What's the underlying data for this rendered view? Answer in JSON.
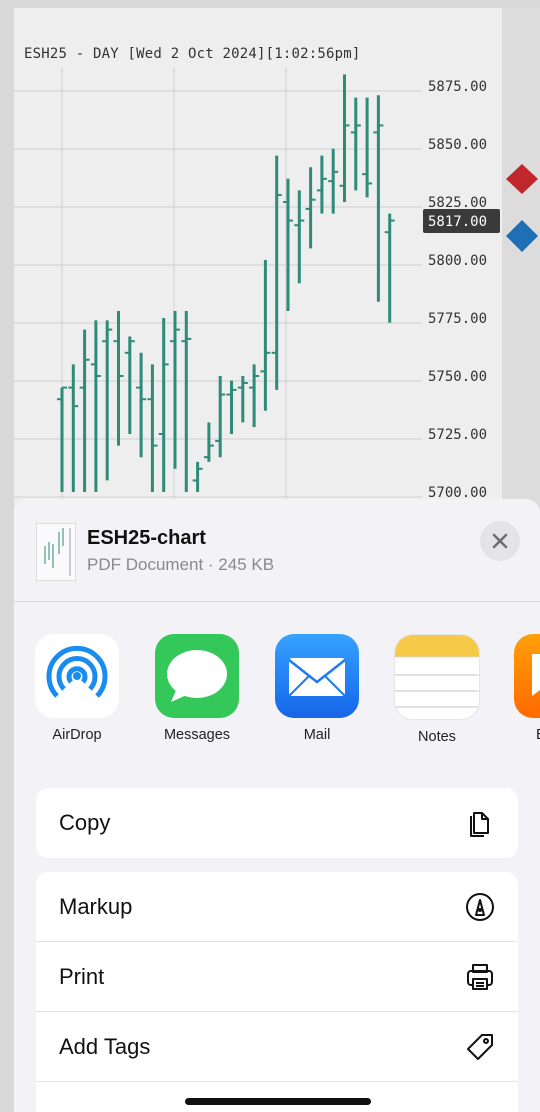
{
  "chart": {
    "title": "ESH25 - DAY [Wed 2 Oct 2024][1:02:56pm]",
    "price_labels": [
      "5875.00",
      "5850.00",
      "5825.00",
      "5800.00",
      "5775.00",
      "5750.00",
      "5725.00",
      "5700.00"
    ],
    "current_price": "5817.00",
    "colors": {
      "bar": "#2e8b7a",
      "grid": "#d0d0d0",
      "current_bg": "#3a3a3a",
      "red_marker": "#c0272d",
      "blue_marker": "#1f6fb5"
    }
  },
  "chart_data": {
    "type": "ohlc",
    "title": "ESH25 - DAY [Wed 2 Oct 2024][1:02:56pm]",
    "ylim": [
      5700,
      5880
    ],
    "y_ticks": [
      5700,
      5725,
      5750,
      5775,
      5800,
      5825,
      5850,
      5875
    ],
    "bars": [
      {
        "open": 5740,
        "high": 5745,
        "low": 5700,
        "close": 5745
      },
      {
        "open": 5745,
        "high": 5755,
        "low": 5700,
        "close": 5737
      },
      {
        "open": 5745,
        "high": 5770,
        "low": 5700,
        "close": 5757
      },
      {
        "open": 5755,
        "high": 5774,
        "low": 5700,
        "close": 5750
      },
      {
        "open": 5765,
        "high": 5774,
        "low": 5705,
        "close": 5770
      },
      {
        "open": 5765,
        "high": 5778,
        "low": 5720,
        "close": 5750
      },
      {
        "open": 5760,
        "high": 5767,
        "low": 5725,
        "close": 5765
      },
      {
        "open": 5745,
        "high": 5760,
        "low": 5715,
        "close": 5740
      },
      {
        "open": 5740,
        "high": 5755,
        "low": 5700,
        "close": 5720
      },
      {
        "open": 5725,
        "high": 5775,
        "low": 5700,
        "close": 5755
      },
      {
        "open": 5765,
        "high": 5778,
        "low": 5710,
        "close": 5770
      },
      {
        "open": 5765,
        "high": 5778,
        "low": 5700,
        "close": 5766
      },
      {
        "open": 5705,
        "high": 5713,
        "low": 5700,
        "close": 5710
      },
      {
        "open": 5715,
        "high": 5730,
        "low": 5713,
        "close": 5720
      },
      {
        "open": 5722,
        "high": 5750,
        "low": 5715,
        "close": 5742
      },
      {
        "open": 5742,
        "high": 5748,
        "low": 5725,
        "close": 5744
      },
      {
        "open": 5745,
        "high": 5750,
        "low": 5730,
        "close": 5747
      },
      {
        "open": 5745,
        "high": 5755,
        "low": 5728,
        "close": 5750
      },
      {
        "open": 5752,
        "high": 5800,
        "low": 5735,
        "close": 5760
      },
      {
        "open": 5760,
        "high": 5845,
        "low": 5744,
        "close": 5828
      },
      {
        "open": 5825,
        "high": 5835,
        "low": 5778,
        "close": 5817
      },
      {
        "open": 5815,
        "high": 5830,
        "low": 5790,
        "close": 5817
      },
      {
        "open": 5822,
        "high": 5840,
        "low": 5805,
        "close": 5826
      },
      {
        "open": 5830,
        "high": 5845,
        "low": 5820,
        "close": 5835
      },
      {
        "open": 5834,
        "high": 5848,
        "low": 5820,
        "close": 5838
      },
      {
        "open": 5832,
        "high": 5880,
        "low": 5825,
        "close": 5858
      },
      {
        "open": 5855,
        "high": 5870,
        "low": 5830,
        "close": 5858
      },
      {
        "open": 5837,
        "high": 5870,
        "low": 5827,
        "close": 5833
      },
      {
        "open": 5855,
        "high": 5871,
        "low": 5782,
        "close": 5858
      },
      {
        "open": 5812,
        "high": 5820,
        "low": 5773,
        "close": 5817
      }
    ]
  },
  "share_sheet": {
    "file_name": "ESH25-chart",
    "file_info": "PDF Document · 245 KB",
    "apps": [
      {
        "label": "AirDrop",
        "icon": "airdrop-icon"
      },
      {
        "label": "Messages",
        "icon": "messages-icon"
      },
      {
        "label": "Mail",
        "icon": "mail-icon"
      },
      {
        "label": "Notes",
        "icon": "notes-icon"
      },
      {
        "label": "B",
        "icon": "books-icon"
      }
    ],
    "actions_group1": [
      {
        "label": "Copy",
        "icon": "copy-icon"
      }
    ],
    "actions_group2": [
      {
        "label": "Markup",
        "icon": "markup-icon"
      },
      {
        "label": "Print",
        "icon": "print-icon"
      },
      {
        "label": "Add Tags",
        "icon": "tag-icon"
      }
    ]
  }
}
